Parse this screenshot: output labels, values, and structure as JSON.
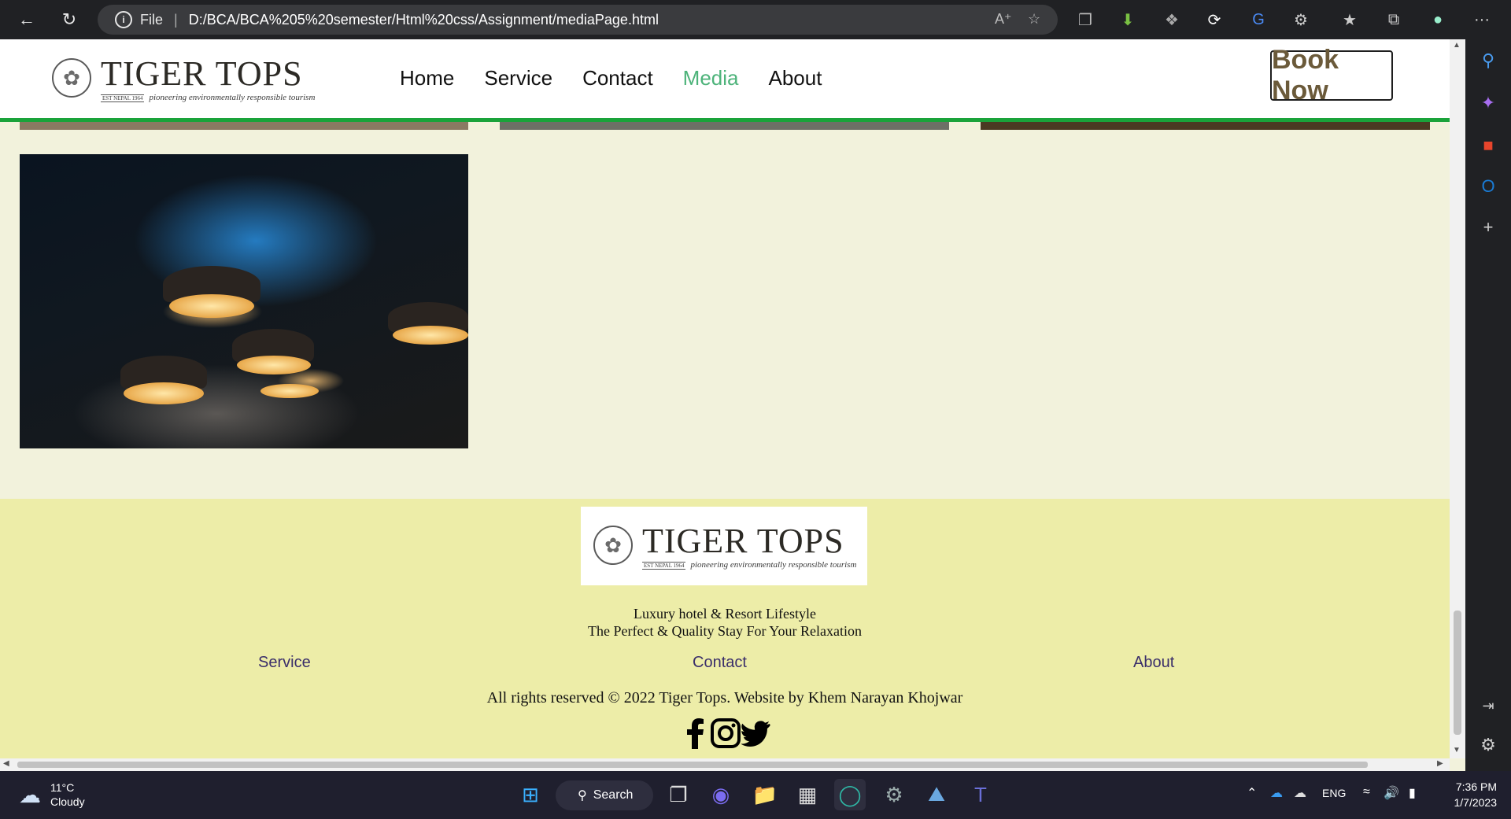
{
  "browser": {
    "file_label": "File",
    "url": "D:/BCA/BCA%205%20semester/Html%20css/Assignment/mediaPage.html",
    "more_label": "···"
  },
  "site": {
    "logo_title": "TIGER TOPS",
    "logo_est": "EST NEPAL 1964",
    "logo_tagline": "pioneering environmentally responsible tourism",
    "nav": [
      "Home",
      "Service",
      "Contact",
      "Media",
      "About"
    ],
    "active_nav": "Media",
    "book_now": "Book Now"
  },
  "footer": {
    "tagline1": "Luxury hotel & Resort Lifestyle",
    "tagline2": "The Perfect & Quality Stay For Your Relaxation",
    "links": [
      "Service",
      "Contact",
      "About"
    ],
    "copyright": "All rights reserved © 2022 Tiger Tops. Website by Khem Narayan Khojwar",
    "social": [
      "facebook-icon",
      "instagram-icon",
      "twitter-icon"
    ]
  },
  "taskbar": {
    "temperature": "11°C",
    "weather": "Cloudy",
    "search_label": "Search",
    "language": "ENG",
    "time": "7:36 PM",
    "date": "1/7/2023"
  },
  "colors": {
    "accent_green": "#1aa33a",
    "active_nav": "#4db37a",
    "footer_bg": "#ededa8",
    "page_bg": "#f2f2dc"
  }
}
